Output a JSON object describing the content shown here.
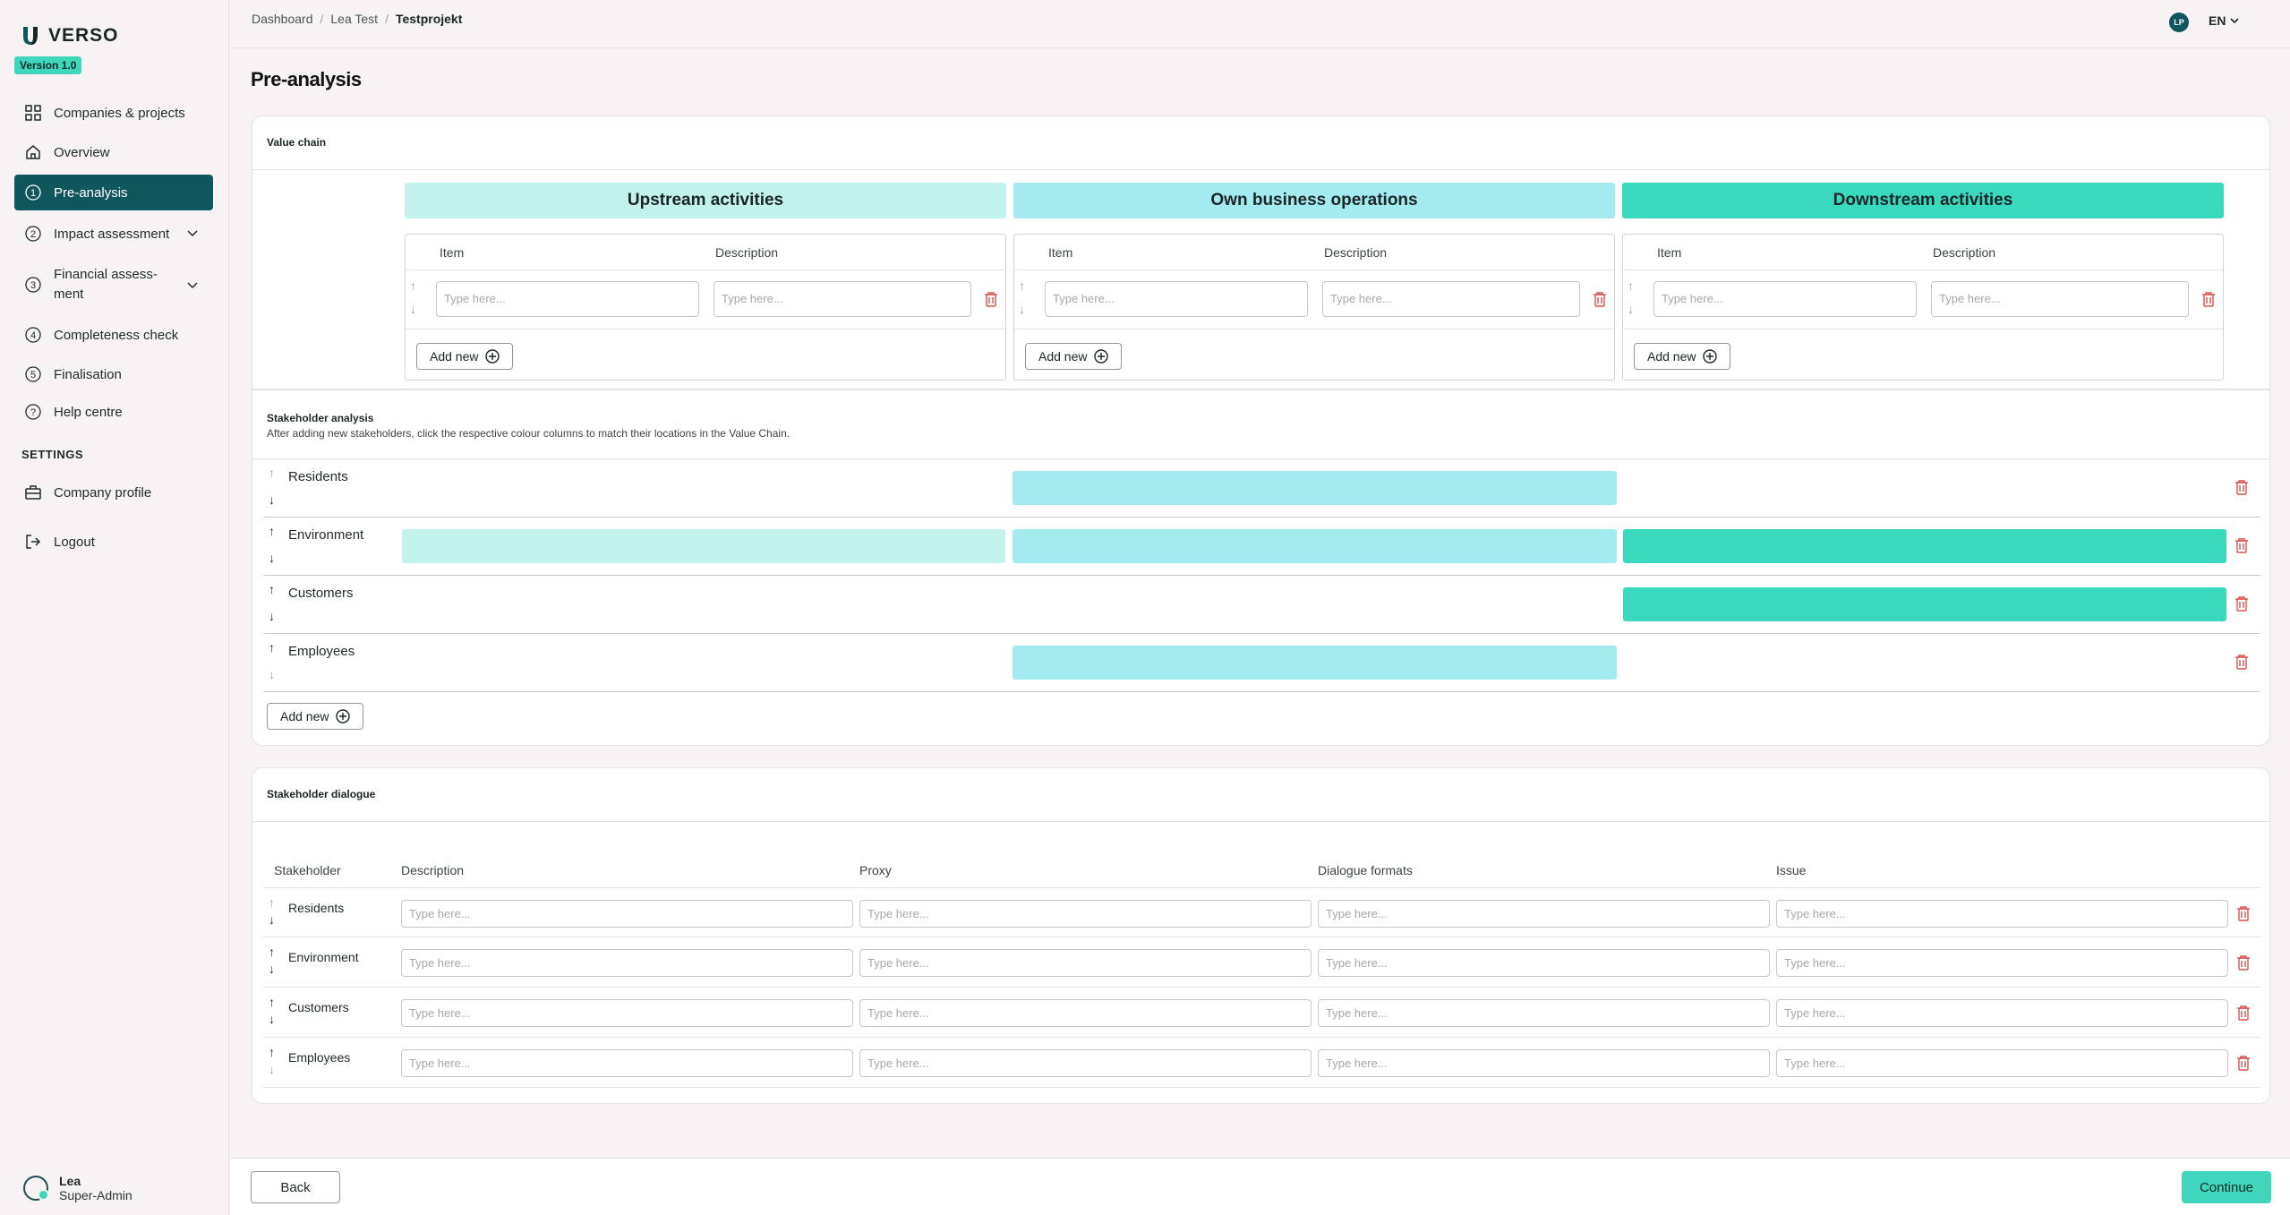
{
  "app": {
    "name": "VERSO",
    "version": "Version 1.0"
  },
  "nav": [
    {
      "label": "Companies & projects"
    },
    {
      "label": "Overview"
    },
    {
      "label": "Pre-analysis"
    },
    {
      "label": "Impact assessment"
    },
    {
      "label": "Financial assess-\nment"
    },
    {
      "label": "Completeness check"
    },
    {
      "label": "Finalisation"
    },
    {
      "label": "Help centre"
    }
  ],
  "settings": {
    "heading": "SETTINGS",
    "company_profile": "Company profile",
    "logout": "Logout"
  },
  "user": {
    "name": "Lea",
    "role": "Super-Admin",
    "initials": "LP"
  },
  "language": "EN",
  "breadcrumb": [
    "Dashboard",
    "Lea Test",
    "Testprojekt"
  ],
  "page_title": "Pre-analysis",
  "value_chain": {
    "title": "Value chain",
    "columns": [
      "Upstream activities",
      "Own business operations",
      "Downstream activities"
    ],
    "item_header": "Item",
    "description_header": "Description",
    "placeholder": "Type here...",
    "add_label": "Add new"
  },
  "stakeholder_analysis": {
    "title": "Stakeholder analysis",
    "description": "After adding new stakeholders, click the respective colour columns to match their locations in the Value Chain.",
    "rows": [
      {
        "name": "Residents"
      },
      {
        "name": "Environment"
      },
      {
        "name": "Customers"
      },
      {
        "name": "Employees"
      }
    ],
    "add_label": "Add new"
  },
  "stakeholder_dialogue": {
    "title": "Stakeholder dialogue",
    "headers": [
      "Stakeholder",
      "Description",
      "Proxy",
      "Dialogue formats",
      "Issue"
    ],
    "rows": [
      {
        "name": "Residents"
      },
      {
        "name": "Environment"
      },
      {
        "name": "Customers"
      },
      {
        "name": "Employees"
      }
    ],
    "placeholder": "Type here..."
  },
  "footer": {
    "back": "Back",
    "continue": "Continue"
  },
  "colors": {
    "upstream": "#c3f3ed",
    "own": "#a4ebf0",
    "downstream": "#3ad8bd",
    "accent": "#10575d",
    "danger": "#d9534f"
  }
}
